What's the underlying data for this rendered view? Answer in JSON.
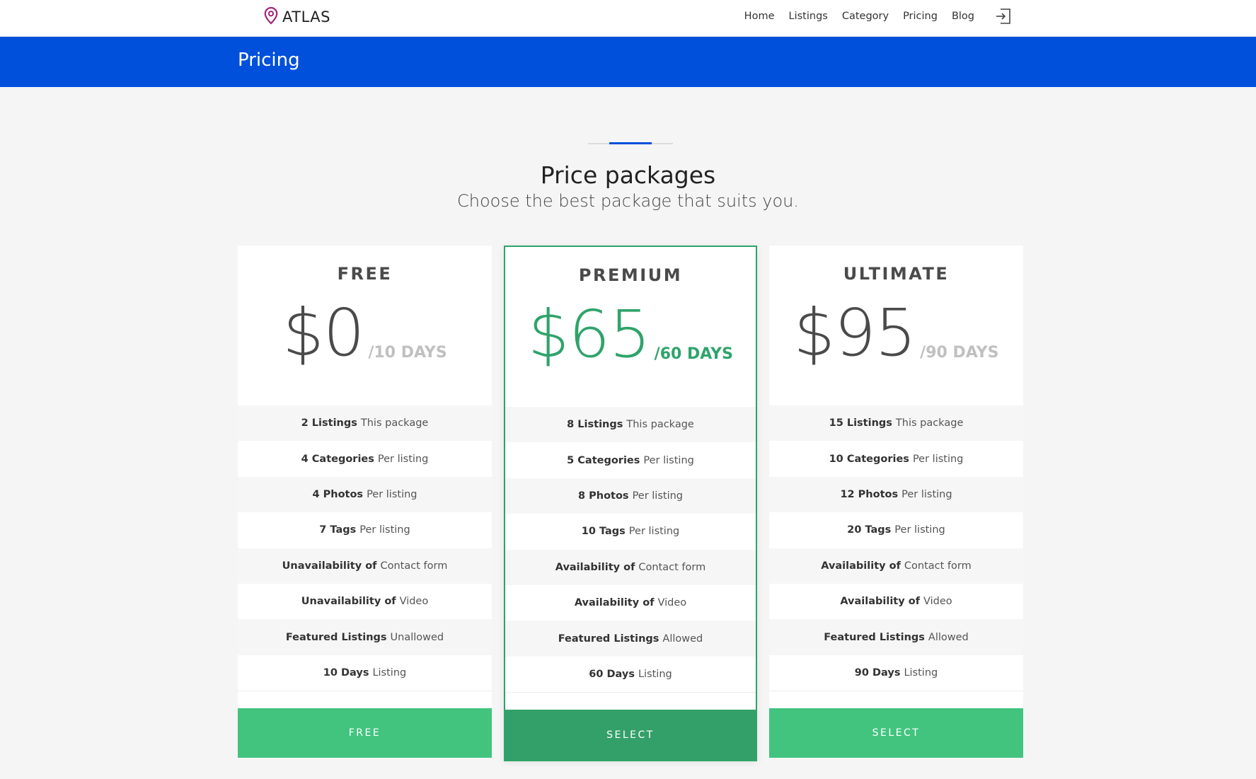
{
  "header": {
    "logo_text": "ATLAS",
    "nav": [
      "Home",
      "Listings",
      "Category",
      "Pricing",
      "Blog"
    ]
  },
  "banner": {
    "title": "Pricing"
  },
  "section": {
    "title": "Price packages",
    "subtitle": "Choose the best package that suits you."
  },
  "plans": [
    {
      "name": "FREE",
      "price": "$0",
      "period": "/10 DAYS",
      "features": [
        {
          "strong": "2 Listings",
          "text": "This package"
        },
        {
          "strong": "4 Categories",
          "text": "Per listing"
        },
        {
          "strong": "4 Photos",
          "text": "Per listing"
        },
        {
          "strong": "7 Tags",
          "text": "Per listing"
        },
        {
          "strong": "Unavailability of",
          "text": "Contact form"
        },
        {
          "strong": "Unavailability of",
          "text": "Video"
        },
        {
          "strong": "Featured Listings",
          "text": "Unallowed"
        },
        {
          "strong": "10 Days",
          "text": "Listing"
        }
      ],
      "button": "FREE"
    },
    {
      "name": "PREMIUM",
      "price": "$65",
      "period": "/60 DAYS",
      "features": [
        {
          "strong": "8 Listings",
          "text": "This package"
        },
        {
          "strong": "5 Categories",
          "text": "Per listing"
        },
        {
          "strong": "8 Photos",
          "text": "Per listing"
        },
        {
          "strong": "10 Tags",
          "text": "Per listing"
        },
        {
          "strong": "Availability of",
          "text": "Contact form"
        },
        {
          "strong": "Availability of",
          "text": "Video"
        },
        {
          "strong": "Featured Listings",
          "text": "Allowed"
        },
        {
          "strong": "60 Days",
          "text": "Listing"
        }
      ],
      "button": "SELECT"
    },
    {
      "name": "ULTIMATE",
      "price": "$95",
      "period": "/90 DAYS",
      "features": [
        {
          "strong": "15 Listings",
          "text": "This package"
        },
        {
          "strong": "10 Categories",
          "text": "Per listing"
        },
        {
          "strong": "12 Photos",
          "text": "Per listing"
        },
        {
          "strong": "20 Tags",
          "text": "Per listing"
        },
        {
          "strong": "Availability of",
          "text": "Contact form"
        },
        {
          "strong": "Availability of",
          "text": "Video"
        },
        {
          "strong": "Featured Listings",
          "text": "Allowed"
        },
        {
          "strong": "90 Days",
          "text": "Listing"
        }
      ],
      "button": "SELECT"
    }
  ],
  "colors": {
    "brand_blue": "#0050dc",
    "accent_green": "#2fa36b",
    "button_green": "#42c47f",
    "logo_pin": "#a0247a"
  }
}
